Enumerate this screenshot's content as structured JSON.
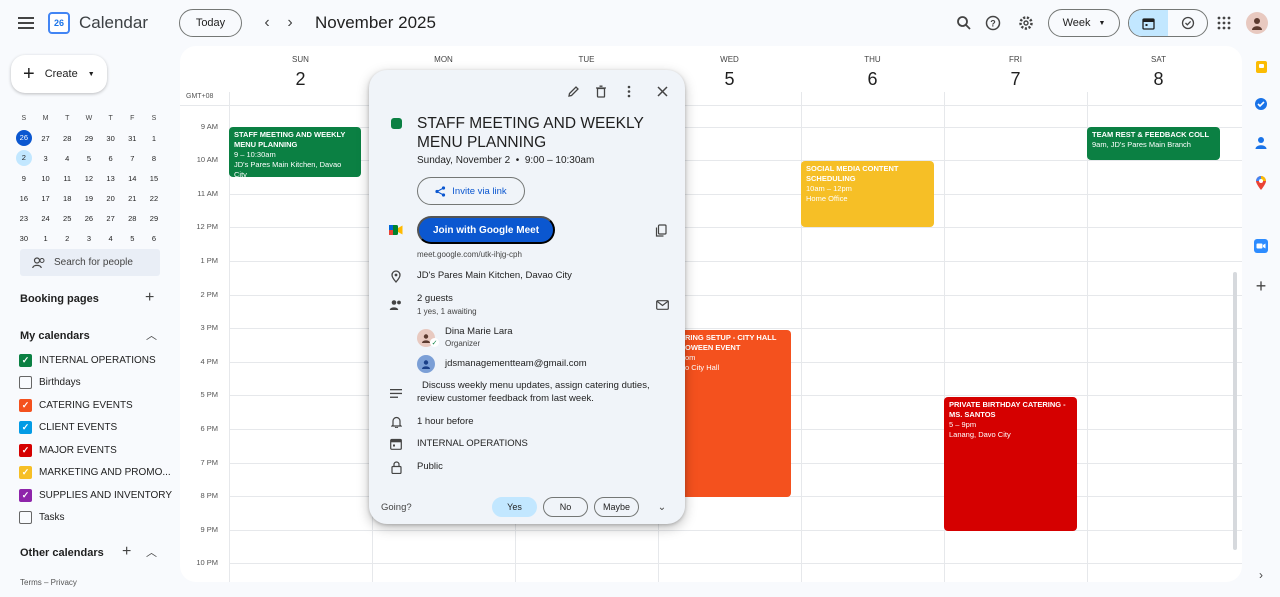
{
  "header": {
    "app_title": "Calendar",
    "logo_text": "26",
    "today_label": "Today",
    "month_title": "November 2025",
    "view_label": "Week"
  },
  "sidebar": {
    "create_label": "Create",
    "mini_calendar": {
      "weekdays": [
        "S",
        "M",
        "T",
        "W",
        "T",
        "F",
        "S"
      ],
      "weeks": [
        [
          "26",
          "27",
          "28",
          "29",
          "30",
          "31",
          "1"
        ],
        [
          "2",
          "3",
          "4",
          "5",
          "6",
          "7",
          "8"
        ],
        [
          "9",
          "10",
          "11",
          "12",
          "13",
          "14",
          "15"
        ],
        [
          "16",
          "17",
          "18",
          "19",
          "20",
          "21",
          "22"
        ],
        [
          "23",
          "24",
          "25",
          "26",
          "27",
          "28",
          "29"
        ],
        [
          "30",
          "1",
          "2",
          "3",
          "4",
          "5",
          "6"
        ]
      ]
    },
    "search_people_placeholder": "Search for people",
    "booking_pages": "Booking pages",
    "my_calendars": "My calendars",
    "calendars": [
      {
        "label": "INTERNAL OPERATIONS",
        "color": "#0b8043",
        "checked": true
      },
      {
        "label": "Birthdays",
        "color": "#666666",
        "checked": false
      },
      {
        "label": "CATERING EVENTS",
        "color": "#f4511e",
        "checked": true
      },
      {
        "label": "CLIENT EVENTS",
        "color": "#039be5",
        "checked": true
      },
      {
        "label": "MAJOR EVENTS",
        "color": "#d50000",
        "checked": true
      },
      {
        "label": "MARKETING AND PROMO...",
        "color": "#f6bf26",
        "checked": true
      },
      {
        "label": "SUPPLIES AND INVENTORY",
        "color": "#8e24aa",
        "checked": true
      },
      {
        "label": "Tasks",
        "color": "#666666",
        "checked": false
      }
    ],
    "other_calendars": "Other calendars",
    "footer": "Terms – Privacy"
  },
  "week": {
    "timezone": "GMT+08",
    "days": [
      {
        "dow": "SUN",
        "num": "2"
      },
      {
        "dow": "MON",
        "num": ""
      },
      {
        "dow": "TUE",
        "num": ""
      },
      {
        "dow": "WED",
        "num": "5"
      },
      {
        "dow": "THU",
        "num": "6"
      },
      {
        "dow": "FRI",
        "num": "7"
      },
      {
        "dow": "SAT",
        "num": "8"
      }
    ],
    "hours": [
      "9 AM",
      "10 AM",
      "11 AM",
      "12 PM",
      "1 PM",
      "2 PM",
      "3 PM",
      "4 PM",
      "5 PM",
      "6 PM",
      "7 PM",
      "8 PM",
      "9 PM",
      "10 PM"
    ],
    "events": [
      {
        "title": "STAFF MEETING AND WEEKLY MENU PLANNING",
        "time": "9 – 10:30am",
        "location": "JD's Pares Main Kitchen, Davao City",
        "color": "#0b8043"
      },
      {
        "title": "SOCIAL MEDIA CONTENT SCHEDULING",
        "time": "10am – 12pm",
        "location": "Home Office",
        "color": "#f6bf26"
      },
      {
        "title": "TEAM REST & FEEDBACK COLL",
        "time": "9am, JD's Pares Main Branch",
        "location": "",
        "color": "#0b8043"
      },
      {
        "title": "RING SETUP - CITY HALL OWEEN EVENT",
        "time": "om",
        "location": "o City Hall",
        "color": "#f4511e"
      },
      {
        "title": "PRIVATE BIRTHDAY CATERING - MS. SANTOS",
        "time": "5 – 9pm",
        "location": "Lanang, Davo City",
        "color": "#d50000"
      }
    ]
  },
  "popup": {
    "title": "STAFF MEETING AND WEEKLY MENU PLANNING",
    "date": "Sunday, November 2",
    "time": "9:00 – 10:30am",
    "invite_label": "Invite via link",
    "meet_label": "Join with Google Meet",
    "meet_link": "meet.google.com/utk-ihjg-cph",
    "location": "JD's Pares Main Kitchen, Davao City",
    "guests_count": "2 guests",
    "guests_status": "1 yes, 1 awaiting",
    "organizer_name": "Dina Marie Lara",
    "organizer_role": "Organizer",
    "guest_email": "jdsmanagementteam@gmail.com",
    "description": "Discuss weekly menu updates, assign catering duties, review customer feedback from last week.",
    "reminder": "1 hour before",
    "calendar": "INTERNAL OPERATIONS",
    "visibility": "Public",
    "going_label": "Going?",
    "rsvp_yes": "Yes",
    "rsvp_no": "No",
    "rsvp_maybe": "Maybe"
  }
}
